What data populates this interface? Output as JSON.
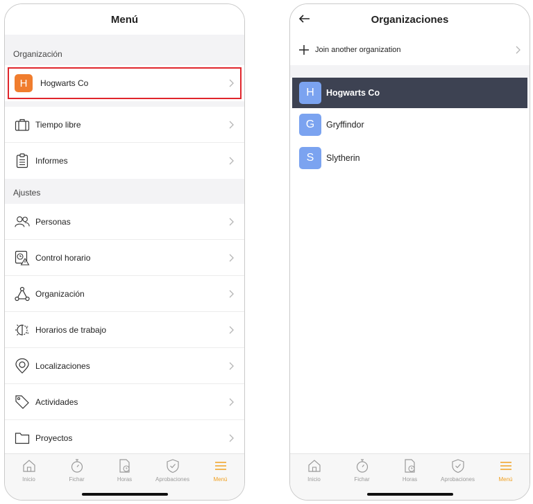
{
  "left": {
    "title": "Menú",
    "section_org": "Organización",
    "org": {
      "initial": "H",
      "name": "Hogwarts Co"
    },
    "items_top": [
      {
        "label": "Tiempo libre",
        "icon": "suitcase-icon"
      },
      {
        "label": "Informes",
        "icon": "clipboard-icon"
      }
    ],
    "section_settings": "Ajustes",
    "items_settings": [
      {
        "label": "Personas",
        "icon": "people-icon"
      },
      {
        "label": "Control horario",
        "icon": "clock-warning-icon"
      },
      {
        "label": "Organización",
        "icon": "network-icon"
      },
      {
        "label": "Horarios de trabajo",
        "icon": "day-night-icon"
      },
      {
        "label": "Localizaciones",
        "icon": "location-pin-icon"
      },
      {
        "label": "Actividades",
        "icon": "tag-icon"
      },
      {
        "label": "Proyectos",
        "icon": "folder-icon"
      }
    ]
  },
  "right": {
    "title": "Organizaciones",
    "join_label": "Join another organization",
    "orgs": [
      {
        "initial": "H",
        "name": "Hogwarts Co",
        "selected": true
      },
      {
        "initial": "G",
        "name": "Gryffindor",
        "selected": false
      },
      {
        "initial": "S",
        "name": "Slytherin",
        "selected": false
      }
    ]
  },
  "tabbar": {
    "tabs": [
      {
        "label": "Inicio",
        "icon": "home-icon"
      },
      {
        "label": "Fichar",
        "icon": "stopwatch-icon"
      },
      {
        "label": "Horas",
        "icon": "document-clock-icon"
      },
      {
        "label": "Aprobaciones",
        "icon": "shield-check-icon"
      },
      {
        "label": "Menú",
        "icon": "menu-icon",
        "active": true
      }
    ]
  },
  "colors": {
    "accent": "#f0a020",
    "highlight_border": "#e0252b",
    "org_avatar_orange": "#f07d2e",
    "org_avatar_blue": "#7ba3f0",
    "selected_row": "#3d4252"
  }
}
